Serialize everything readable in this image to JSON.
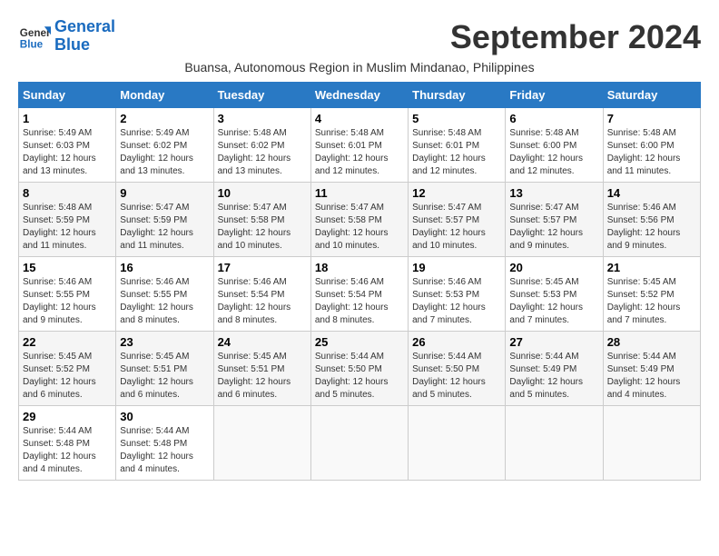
{
  "header": {
    "logo_line1": "General",
    "logo_line2": "Blue",
    "month_title": "September 2024",
    "subtitle": "Buansa, Autonomous Region in Muslim Mindanao, Philippines"
  },
  "days_of_week": [
    "Sunday",
    "Monday",
    "Tuesday",
    "Wednesday",
    "Thursday",
    "Friday",
    "Saturday"
  ],
  "weeks": [
    [
      {
        "day": "1",
        "sunrise": "5:49 AM",
        "sunset": "6:03 PM",
        "daylight": "12 hours and 13 minutes."
      },
      {
        "day": "2",
        "sunrise": "5:49 AM",
        "sunset": "6:02 PM",
        "daylight": "12 hours and 13 minutes."
      },
      {
        "day": "3",
        "sunrise": "5:48 AM",
        "sunset": "6:02 PM",
        "daylight": "12 hours and 13 minutes."
      },
      {
        "day": "4",
        "sunrise": "5:48 AM",
        "sunset": "6:01 PM",
        "daylight": "12 hours and 12 minutes."
      },
      {
        "day": "5",
        "sunrise": "5:48 AM",
        "sunset": "6:01 PM",
        "daylight": "12 hours and 12 minutes."
      },
      {
        "day": "6",
        "sunrise": "5:48 AM",
        "sunset": "6:00 PM",
        "daylight": "12 hours and 12 minutes."
      },
      {
        "day": "7",
        "sunrise": "5:48 AM",
        "sunset": "6:00 PM",
        "daylight": "12 hours and 11 minutes."
      }
    ],
    [
      {
        "day": "8",
        "sunrise": "5:48 AM",
        "sunset": "5:59 PM",
        "daylight": "12 hours and 11 minutes."
      },
      {
        "day": "9",
        "sunrise": "5:47 AM",
        "sunset": "5:59 PM",
        "daylight": "12 hours and 11 minutes."
      },
      {
        "day": "10",
        "sunrise": "5:47 AM",
        "sunset": "5:58 PM",
        "daylight": "12 hours and 10 minutes."
      },
      {
        "day": "11",
        "sunrise": "5:47 AM",
        "sunset": "5:58 PM",
        "daylight": "12 hours and 10 minutes."
      },
      {
        "day": "12",
        "sunrise": "5:47 AM",
        "sunset": "5:57 PM",
        "daylight": "12 hours and 10 minutes."
      },
      {
        "day": "13",
        "sunrise": "5:47 AM",
        "sunset": "5:57 PM",
        "daylight": "12 hours and 9 minutes."
      },
      {
        "day": "14",
        "sunrise": "5:46 AM",
        "sunset": "5:56 PM",
        "daylight": "12 hours and 9 minutes."
      }
    ],
    [
      {
        "day": "15",
        "sunrise": "5:46 AM",
        "sunset": "5:55 PM",
        "daylight": "12 hours and 9 minutes."
      },
      {
        "day": "16",
        "sunrise": "5:46 AM",
        "sunset": "5:55 PM",
        "daylight": "12 hours and 8 minutes."
      },
      {
        "day": "17",
        "sunrise": "5:46 AM",
        "sunset": "5:54 PM",
        "daylight": "12 hours and 8 minutes."
      },
      {
        "day": "18",
        "sunrise": "5:46 AM",
        "sunset": "5:54 PM",
        "daylight": "12 hours and 8 minutes."
      },
      {
        "day": "19",
        "sunrise": "5:46 AM",
        "sunset": "5:53 PM",
        "daylight": "12 hours and 7 minutes."
      },
      {
        "day": "20",
        "sunrise": "5:45 AM",
        "sunset": "5:53 PM",
        "daylight": "12 hours and 7 minutes."
      },
      {
        "day": "21",
        "sunrise": "5:45 AM",
        "sunset": "5:52 PM",
        "daylight": "12 hours and 7 minutes."
      }
    ],
    [
      {
        "day": "22",
        "sunrise": "5:45 AM",
        "sunset": "5:52 PM",
        "daylight": "12 hours and 6 minutes."
      },
      {
        "day": "23",
        "sunrise": "5:45 AM",
        "sunset": "5:51 PM",
        "daylight": "12 hours and 6 minutes."
      },
      {
        "day": "24",
        "sunrise": "5:45 AM",
        "sunset": "5:51 PM",
        "daylight": "12 hours and 6 minutes."
      },
      {
        "day": "25",
        "sunrise": "5:44 AM",
        "sunset": "5:50 PM",
        "daylight": "12 hours and 5 minutes."
      },
      {
        "day": "26",
        "sunrise": "5:44 AM",
        "sunset": "5:50 PM",
        "daylight": "12 hours and 5 minutes."
      },
      {
        "day": "27",
        "sunrise": "5:44 AM",
        "sunset": "5:49 PM",
        "daylight": "12 hours and 5 minutes."
      },
      {
        "day": "28",
        "sunrise": "5:44 AM",
        "sunset": "5:49 PM",
        "daylight": "12 hours and 4 minutes."
      }
    ],
    [
      {
        "day": "29",
        "sunrise": "5:44 AM",
        "sunset": "5:48 PM",
        "daylight": "12 hours and 4 minutes."
      },
      {
        "day": "30",
        "sunrise": "5:44 AM",
        "sunset": "5:48 PM",
        "daylight": "12 hours and 4 minutes."
      },
      {
        "day": "",
        "sunrise": "",
        "sunset": "",
        "daylight": ""
      },
      {
        "day": "",
        "sunrise": "",
        "sunset": "",
        "daylight": ""
      },
      {
        "day": "",
        "sunrise": "",
        "sunset": "",
        "daylight": ""
      },
      {
        "day": "",
        "sunrise": "",
        "sunset": "",
        "daylight": ""
      },
      {
        "day": "",
        "sunrise": "",
        "sunset": "",
        "daylight": ""
      }
    ]
  ]
}
